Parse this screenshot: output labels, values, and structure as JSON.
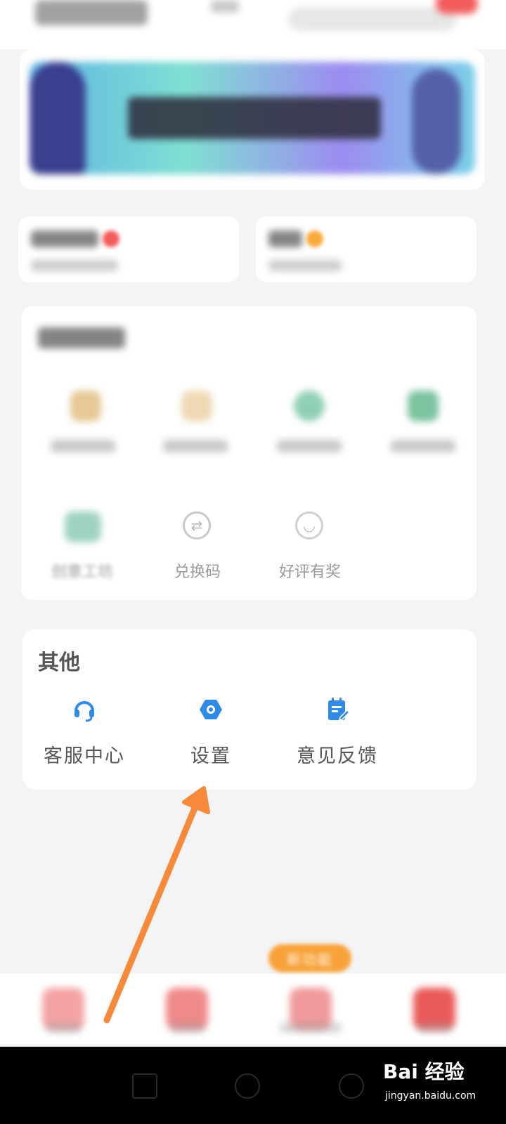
{
  "blocked_section": {
    "row2": [
      {
        "label": "创意工坊",
        "icon": "workshop-icon"
      },
      {
        "label": "兑换码",
        "icon": "exchange-icon"
      },
      {
        "label": "好评有奖",
        "icon": "rating-icon"
      }
    ]
  },
  "other_section": {
    "title": "其他",
    "items": [
      {
        "label": "客服中心",
        "icon": "headset-icon"
      },
      {
        "label": "设置",
        "icon": "settings-icon"
      },
      {
        "label": "意见反馈",
        "icon": "feedback-icon"
      }
    ]
  },
  "bottom_nav": {
    "new_feature_badge": "新功能"
  },
  "watermark": {
    "brand": "Bai 经验",
    "site": "jingyan.baidu.com"
  },
  "colors": {
    "accent_blue": "#2f8ae8",
    "arrow_orange": "#f68a3a",
    "badge_orange": "#f8a23a"
  }
}
